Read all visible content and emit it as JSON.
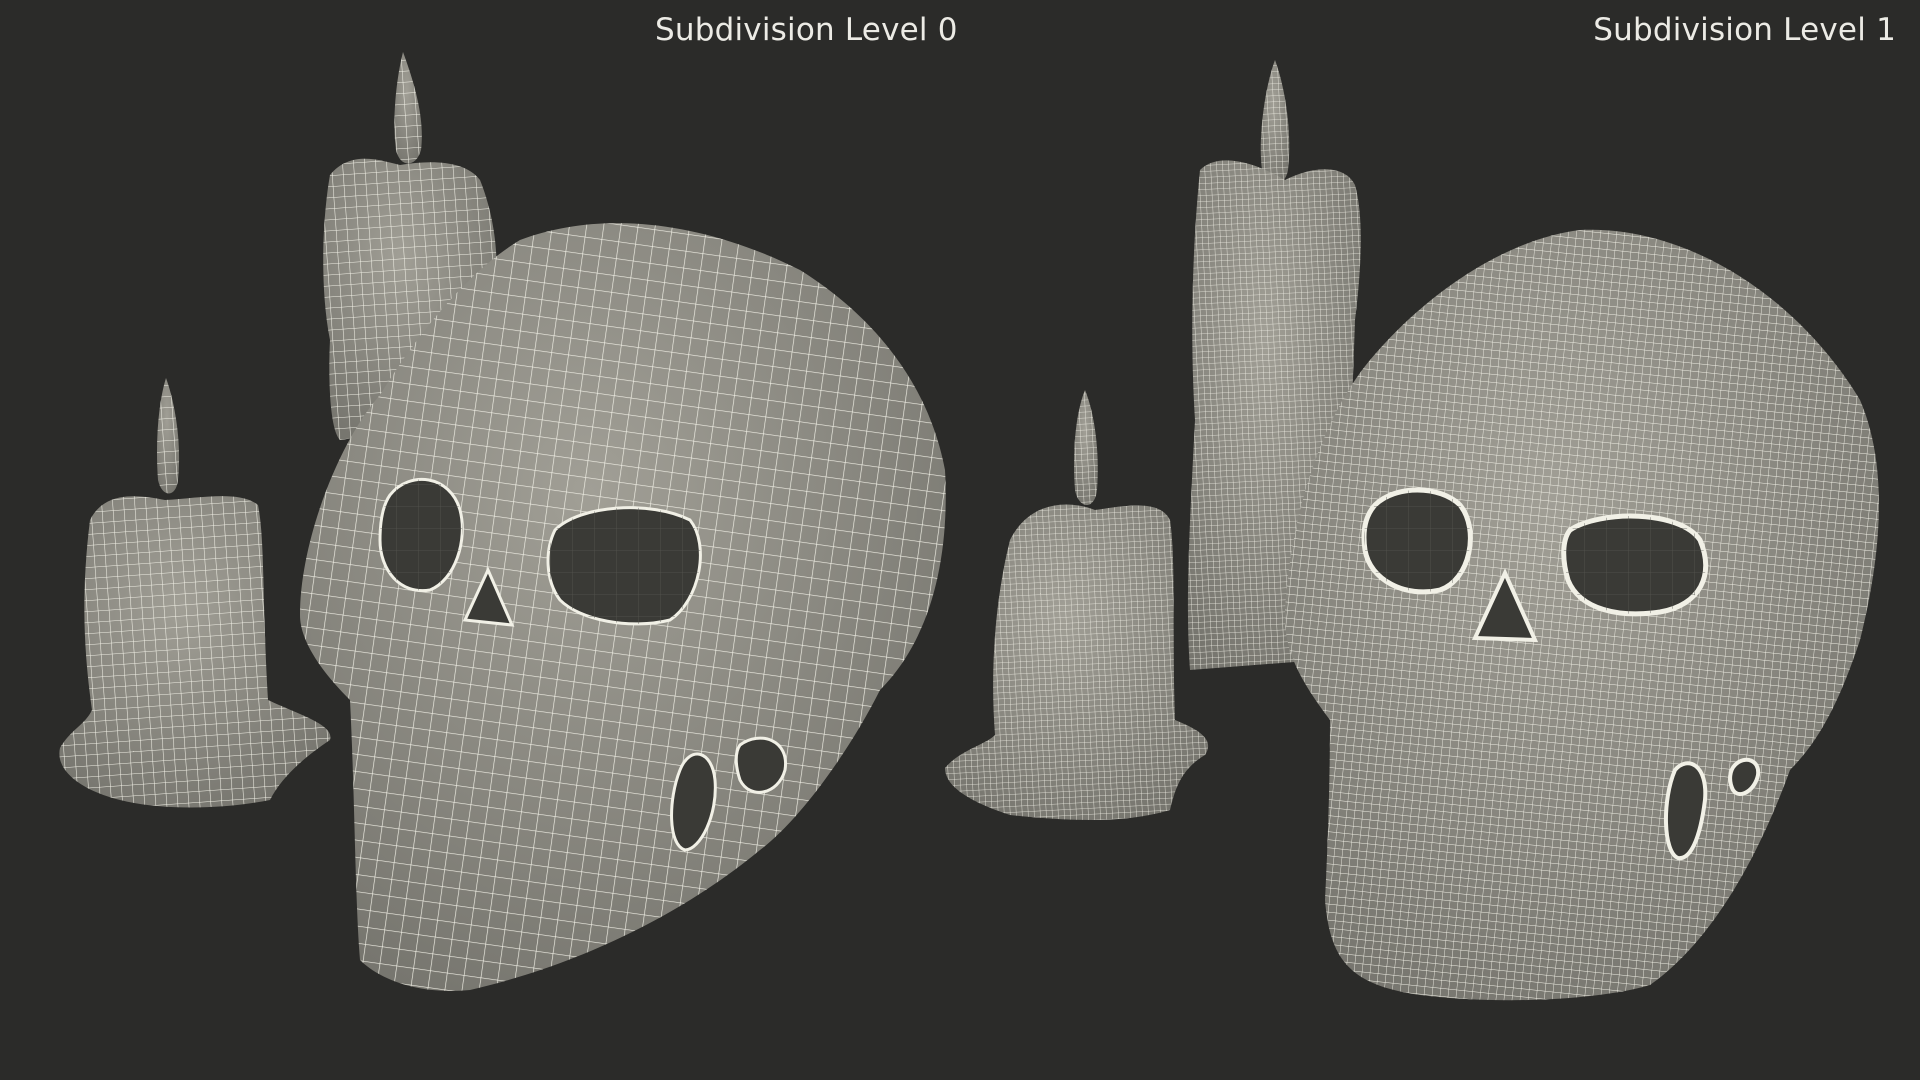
{
  "panels": {
    "left": {
      "label": "Subdivision Level 0"
    },
    "right": {
      "label": "Subdivision Level 1"
    }
  },
  "colors": {
    "background": "#2b2b29",
    "surface": "#8f8f88",
    "wire": "#f1f0e6",
    "hole": "#3a3a36"
  },
  "objects": [
    "skull",
    "tall-candle",
    "short-candle"
  ]
}
